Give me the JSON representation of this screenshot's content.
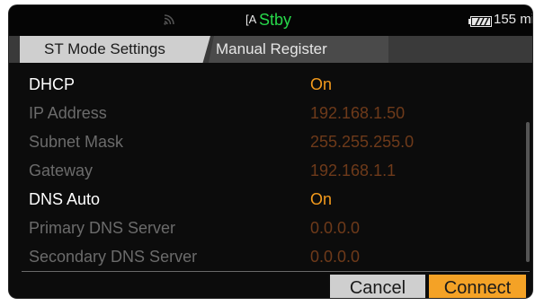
{
  "status": {
    "wifi_icon": "wifi-signal-icon",
    "media_icon_glyph": "[A",
    "record_state": "Stby",
    "battery_icon": "battery-icon",
    "battery_time": "155 min"
  },
  "tabs": [
    {
      "label": "ST Mode Settings",
      "active": true
    },
    {
      "label": "Manual Register",
      "active": false
    }
  ],
  "settings": [
    {
      "label": "DHCP",
      "value": "On",
      "enabled": true
    },
    {
      "label": "IP Address",
      "value": "192.168.1.50",
      "enabled": false
    },
    {
      "label": "Subnet Mask",
      "value": "255.255.255.0",
      "enabled": false
    },
    {
      "label": "Gateway",
      "value": "192.168.1.1",
      "enabled": false
    },
    {
      "label": "DNS Auto",
      "value": "On",
      "enabled": true
    },
    {
      "label": "Primary DNS Server",
      "value": "0.0.0.0",
      "enabled": false
    },
    {
      "label": "Secondary DNS Server",
      "value": "0.0.0.0",
      "enabled": false
    }
  ],
  "buttons": {
    "cancel": "Cancel",
    "connect": "Connect"
  },
  "colors": {
    "accent": "#f4a226",
    "record_state": "#27d84a",
    "value_enabled": "#f39a1c",
    "value_disabled": "#6e3a1a"
  }
}
